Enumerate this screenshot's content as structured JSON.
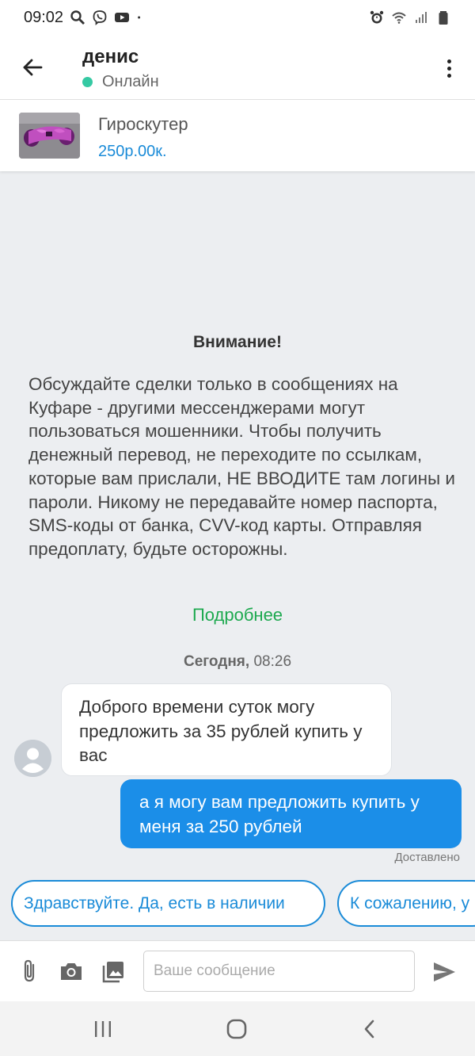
{
  "status_bar": {
    "time": "09:02",
    "left_icons": [
      "search-icon",
      "viber-icon",
      "youtube-icon",
      "dot-icon"
    ],
    "right_icons": [
      "alarm-icon",
      "wifi-icon",
      "signal-icon",
      "battery-icon"
    ]
  },
  "header": {
    "name": "денис",
    "status": "Онлайн",
    "status_color": "#35c9a3"
  },
  "product": {
    "title": "Гироскутер",
    "price": "250р.00к."
  },
  "warning": {
    "title": "Внимание!",
    "text": "Обсуждайте сделки только в сообщениях на Куфаре - другими мессенджерами могут пользоваться мошенники. Чтобы получить денежный перевод, не переходите по ссылкам, которые вам прислали, НЕ ВВОДИТЕ там логины и пароли. Никому не передавайте номер паспорта, SMS-коды от банка, CVV-код карты. Отправляя предоплату, будьте осторожны.",
    "link": "Подробнее"
  },
  "date": {
    "day": "Сегодня,",
    "time": "08:26"
  },
  "messages": [
    {
      "direction": "in",
      "text": "Доброго времени суток могу предложить за 35 рублей купить у вас"
    },
    {
      "direction": "out",
      "text": "а я могу вам предложить купить у меня за 250 рублей",
      "status": "Доставлено"
    }
  ],
  "quick_replies": [
    "Здравствуйте. Да, есть в наличии",
    "К сожалению, у"
  ],
  "input": {
    "placeholder": "Ваше сообщение"
  },
  "colors": {
    "accent": "#1a8bd8",
    "outgoing_bubble": "#1b8ee8",
    "link_green": "#1da94f",
    "chat_background": "#eceef1"
  }
}
